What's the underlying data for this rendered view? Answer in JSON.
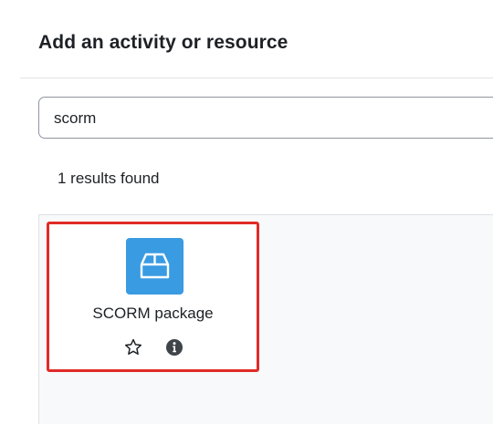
{
  "dialog": {
    "title": "Add an activity or resource"
  },
  "search": {
    "value": "scorm"
  },
  "results": {
    "count_text": "1 results found",
    "items": [
      {
        "label": "SCORM package",
        "icon": "box-icon",
        "icon_bg": "#399be2",
        "star_icon": "star-outline-icon",
        "info_icon": "info-circle-icon"
      }
    ]
  },
  "highlight_color": "#e02b27"
}
